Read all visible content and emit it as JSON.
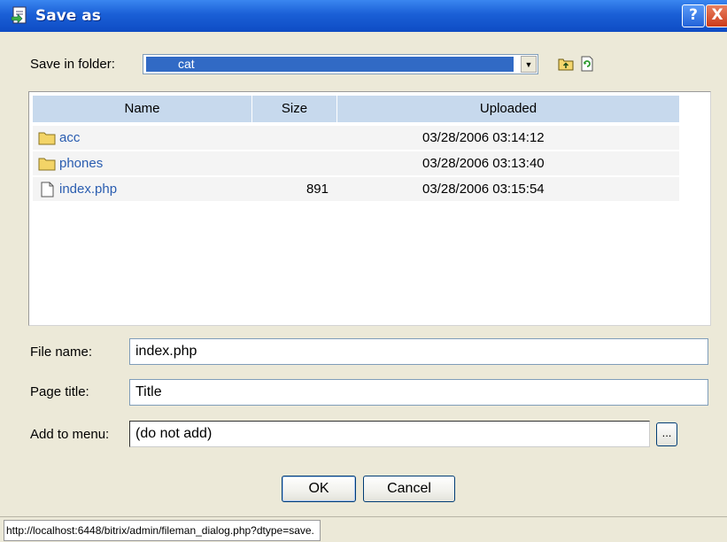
{
  "window": {
    "title": "Save as",
    "help_button": "?",
    "close_button": "X"
  },
  "save_in": {
    "label": "Save in folder:",
    "selected_folder": "cat",
    "icons": [
      "folder-up-icon",
      "refresh-icon"
    ]
  },
  "file_list": {
    "columns": [
      "Name",
      "Size",
      "Uploaded"
    ],
    "rows": [
      {
        "icon": "folder-icon",
        "name": "acc",
        "size": "",
        "uploaded": "03/28/2006 03:14:12"
      },
      {
        "icon": "folder-icon",
        "name": "phones",
        "size": "",
        "uploaded": "03/28/2006 03:13:40"
      },
      {
        "icon": "file-icon",
        "name": "index.php",
        "size": "891",
        "uploaded": "03/28/2006 03:15:54"
      }
    ]
  },
  "form": {
    "file_name_label": "File name:",
    "file_name_value": "index.php",
    "page_title_label": "Page title:",
    "page_title_value": "Title",
    "add_to_menu_label": "Add to menu:",
    "add_to_menu_value": "(do not add)",
    "browse_label": "..."
  },
  "buttons": {
    "ok": "OK",
    "cancel": "Cancel"
  },
  "status_bar": {
    "url": "http://localhost:6448/bitrix/admin/fileman_dialog.php?dtype=save."
  },
  "colors": {
    "titlebar": "#1a5fd6",
    "selection": "#316ac5",
    "link": "#2a5db0",
    "list_header": "#c7d9ed"
  }
}
